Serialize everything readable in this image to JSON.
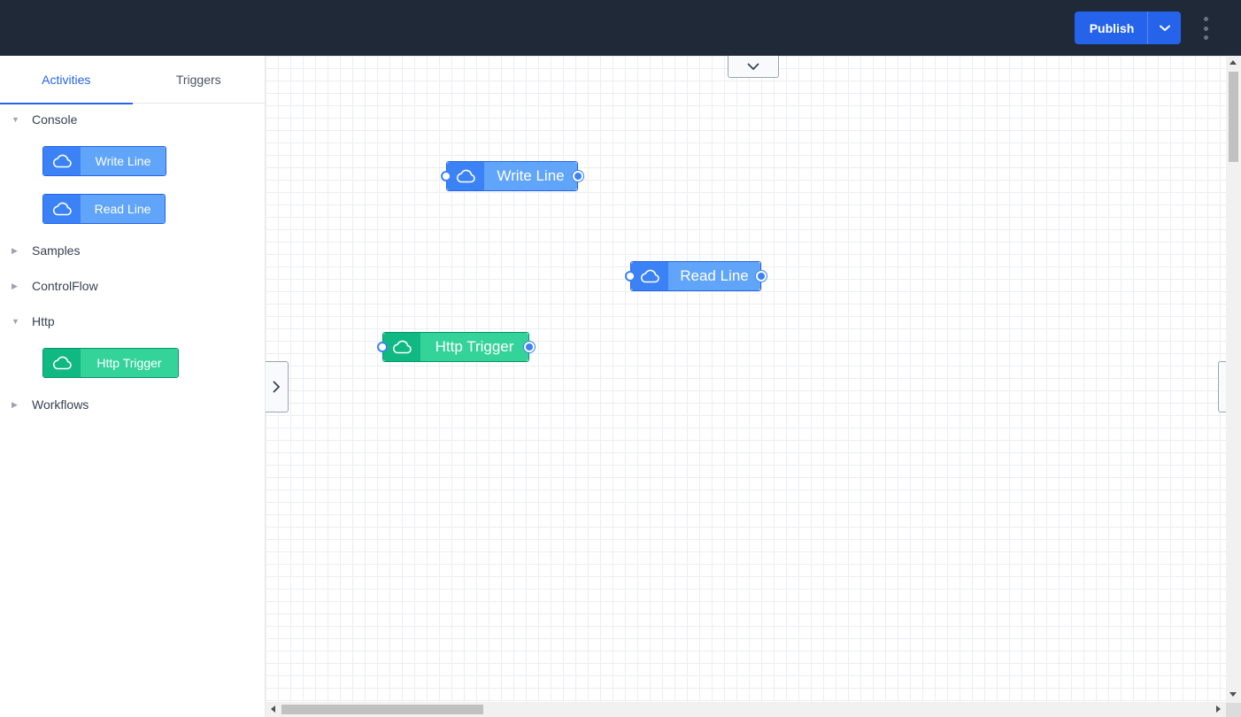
{
  "header": {
    "publish_label": "Publish",
    "publish_dropdown_icon": "chevron-down-icon",
    "more_icon": "kebab-vertical-icon"
  },
  "sidebar": {
    "tabs": [
      {
        "label": "Activities",
        "active": true
      },
      {
        "label": "Triggers",
        "active": false
      }
    ],
    "categories": [
      {
        "label": "Console",
        "expanded": true,
        "activities": [
          {
            "label": "Write Line",
            "icon": "cloud-icon",
            "color": "blue"
          },
          {
            "label": "Read Line",
            "icon": "cloud-icon",
            "color": "blue"
          }
        ]
      },
      {
        "label": "Samples",
        "expanded": false,
        "activities": []
      },
      {
        "label": "ControlFlow",
        "expanded": false,
        "activities": []
      },
      {
        "label": "Http",
        "expanded": true,
        "activities": [
          {
            "label": "Http Trigger",
            "icon": "cloud-icon",
            "color": "green"
          }
        ]
      },
      {
        "label": "Workflows",
        "expanded": false,
        "activities": []
      }
    ]
  },
  "canvas": {
    "nodes": [
      {
        "label": "Write Line",
        "icon": "cloud-icon",
        "color": "blue"
      },
      {
        "label": "Read Line",
        "icon": "cloud-icon",
        "color": "blue"
      },
      {
        "label": "Http Trigger",
        "icon": "cloud-icon",
        "color": "green"
      }
    ]
  },
  "colors": {
    "topbar": "#1f2937",
    "accent": "#2563eb",
    "activity_blue": "#60a5fa",
    "activity_green": "#34d399"
  }
}
